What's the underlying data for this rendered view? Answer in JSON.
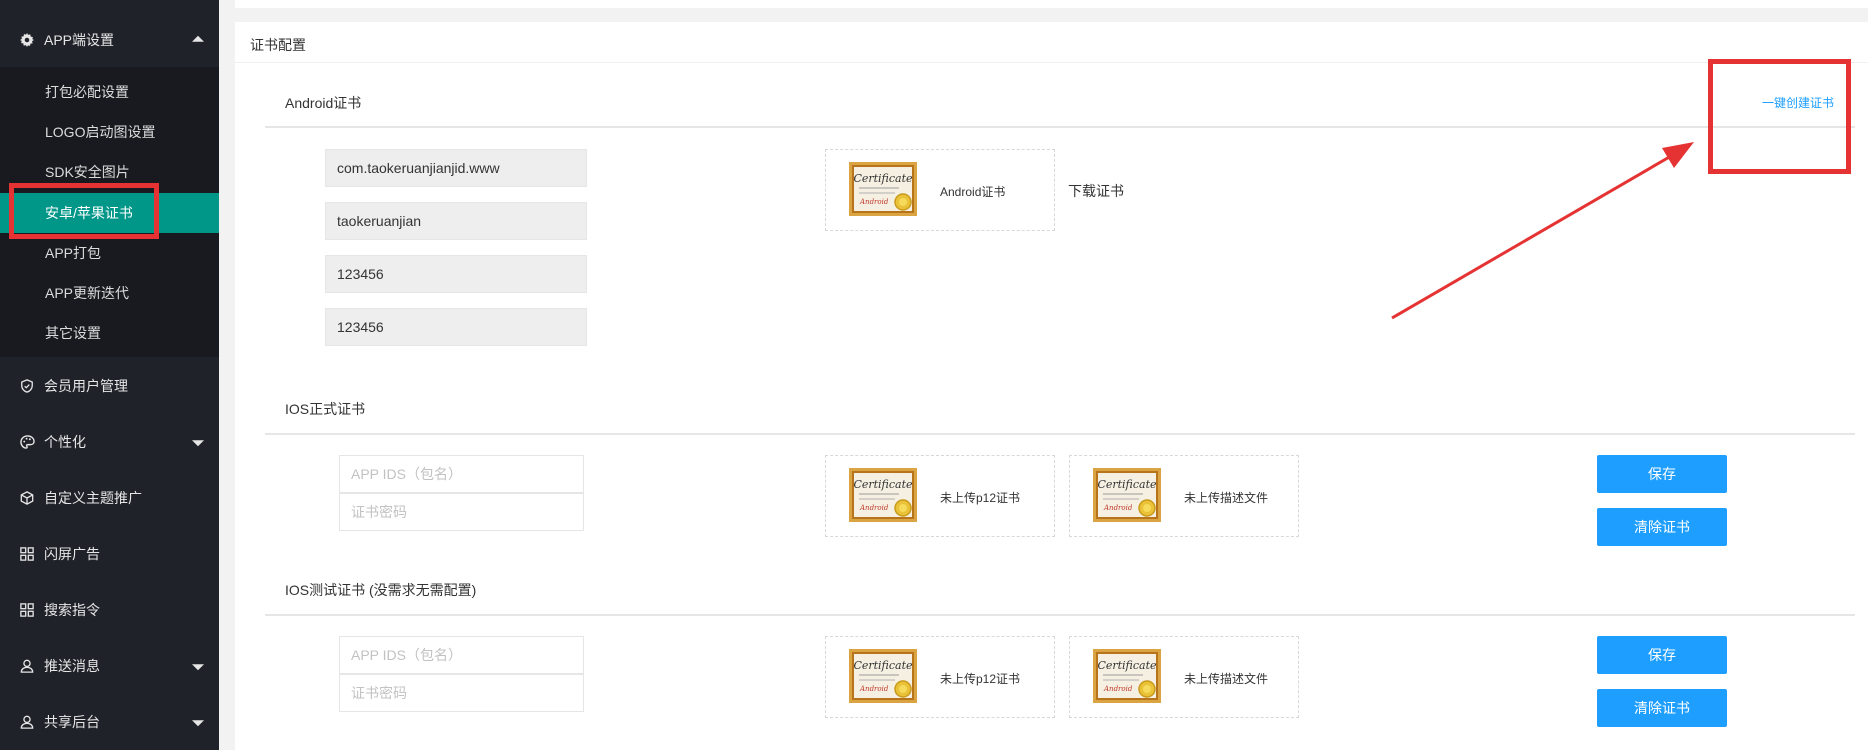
{
  "sidebar": {
    "app_settings": {
      "label": "APP端设置",
      "icon": "gear-icon",
      "expanded": true
    },
    "submenu": [
      {
        "label": "打包必配设置",
        "active": false
      },
      {
        "label": "LOGO启动图设置",
        "active": false
      },
      {
        "label": "SDK安全图片",
        "active": false
      },
      {
        "label": "安卓/苹果证书",
        "active": true
      },
      {
        "label": "APP打包",
        "active": false
      },
      {
        "label": "APP更新迭代",
        "active": false
      },
      {
        "label": "其它设置",
        "active": false
      }
    ],
    "menu": [
      {
        "label": "会员用户管理",
        "icon": "shield-icon",
        "caret": false
      },
      {
        "label": "个性化",
        "icon": "palette-icon",
        "caret": true
      },
      {
        "label": "自定义主题推广",
        "icon": "box-icon",
        "caret": false
      },
      {
        "label": "闪屏广告",
        "icon": "grid-icon",
        "caret": false
      },
      {
        "label": "搜索指令",
        "icon": "grid-icon",
        "caret": false
      },
      {
        "label": "推送消息",
        "icon": "user-icon",
        "caret": true
      },
      {
        "label": "共享后台",
        "icon": "user-icon",
        "caret": true
      }
    ],
    "active_color": "#009688",
    "bg_color": "#20222a"
  },
  "card": {
    "title": "证书配置"
  },
  "android": {
    "title": "Android证书",
    "create_link": "一键创建证书",
    "fields": [
      "com.taokeruanjianjid.www",
      "taokeruanjian",
      "123456",
      "123456"
    ],
    "cert_caption": "Android证书",
    "download_link": "下载证书"
  },
  "ios_release": {
    "title": "IOS正式证书",
    "app_ids_placeholder": "APP IDS（包名）",
    "password_placeholder": "证书密码",
    "p12_caption": "未上传p12证书",
    "profile_caption": "未上传描述文件",
    "save_label": "保存",
    "clear_label": "清除证书"
  },
  "ios_test": {
    "title": "IOS测试证书 (没需求无需配置)",
    "app_ids_placeholder": "APP IDS（包名）",
    "password_placeholder": "证书密码",
    "p12_caption": "未上传p12证书",
    "profile_caption": "未上传描述文件",
    "save_label": "保存",
    "clear_label": "清除证书"
  },
  "colors": {
    "primary_button": "#1e9fff",
    "annotation": "#e53333"
  }
}
